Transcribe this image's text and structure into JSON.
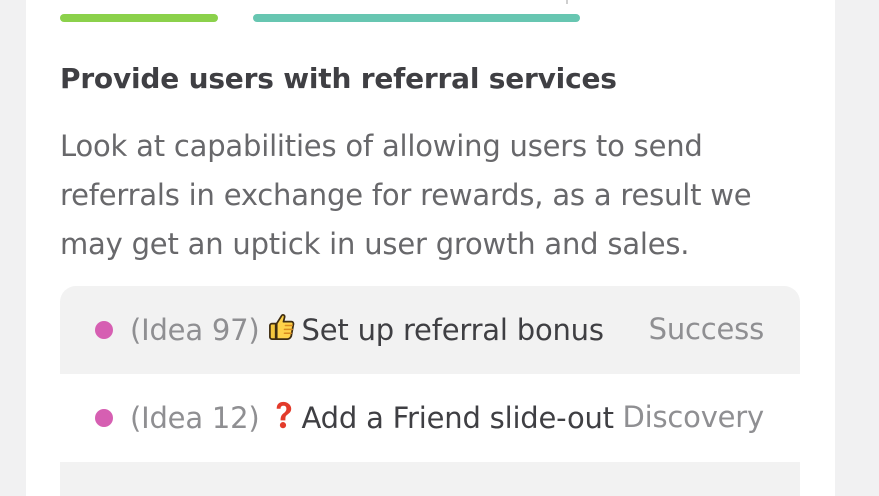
{
  "section": {
    "title": "Provide users with referral services",
    "description": "Look at capabilities of allowing users to send referrals in exchange for rewards, as a result we may get an uptick in user growth and sales."
  },
  "colors": {
    "page_background": "#f1f1f2",
    "card_background": "#ffffff",
    "progress_green": "#8bd14b",
    "progress_teal": "#67c6b1",
    "idea_dot": "#d65fb2",
    "row_shaded": "#f2f2f2"
  },
  "ideas": [
    {
      "id_label": "(Idea 97)",
      "icon": "thumbs-up-icon",
      "title": "Set up referral bonus",
      "status": "Success"
    },
    {
      "id_label": "(Idea 12)",
      "icon": "question-mark-icon",
      "title": "Add a Friend slide-out",
      "status": "Discovery"
    }
  ]
}
